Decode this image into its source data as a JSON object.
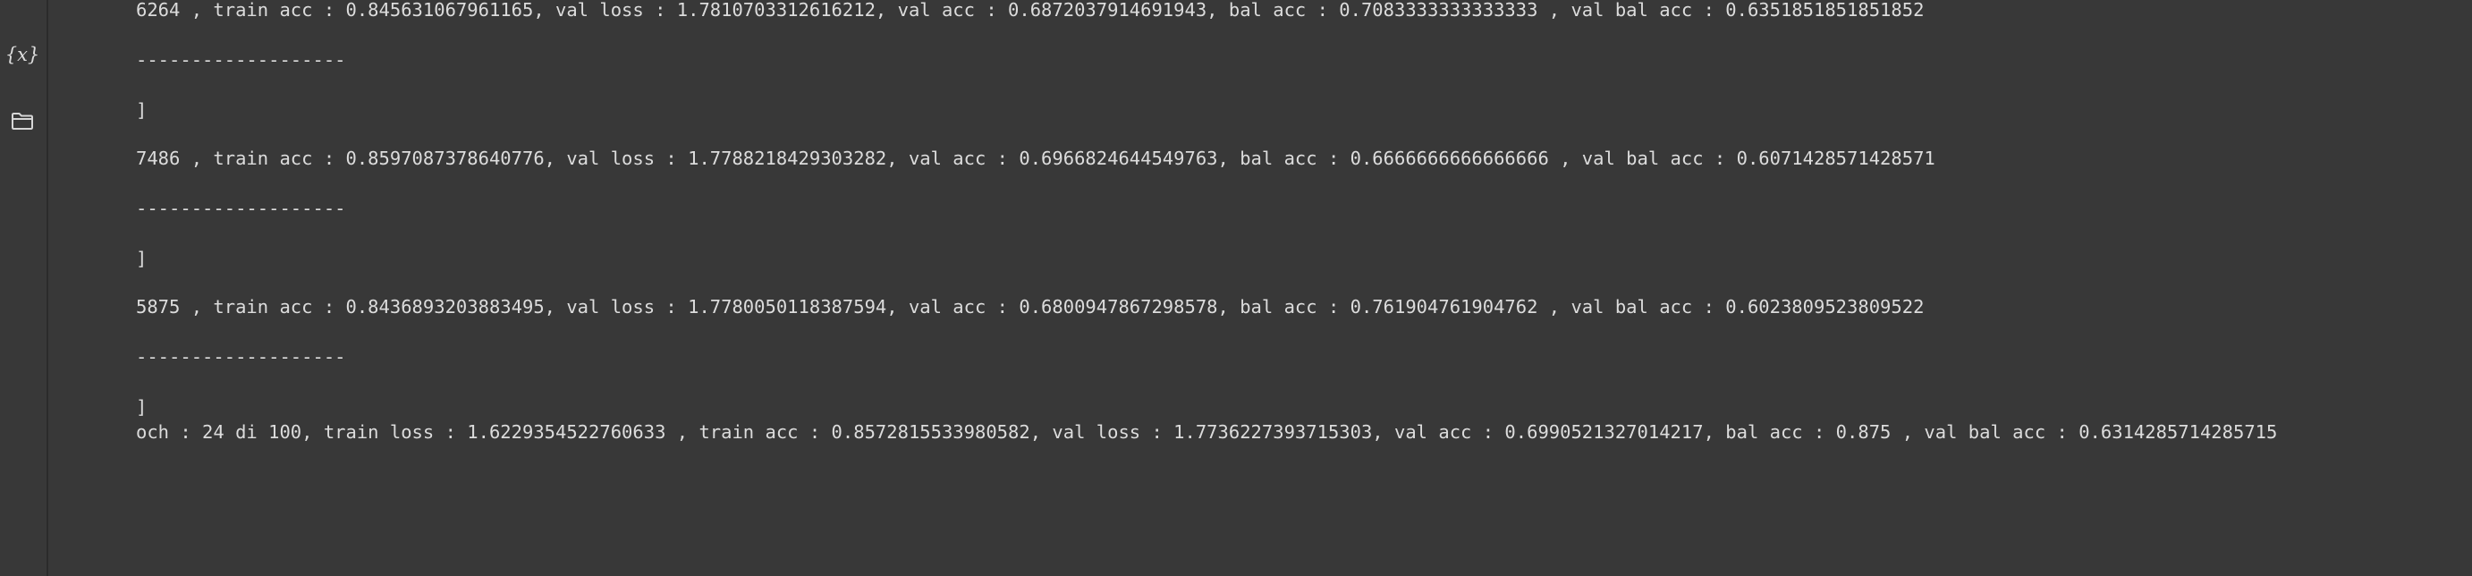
{
  "sidebar": {
    "variables_icon": "{x}",
    "folder_icon": "folder-icon"
  },
  "output": {
    "lines": [
      "6264 , train acc : 0.845631067961165, val loss : 1.7810703312616212, val acc : 0.6872037914691943, bal acc : 0.7083333333333333 , val bal acc : 0.6351851851851852",
      "-------------------",
      "]",
      "7486 , train acc : 0.8597087378640776, val loss : 1.7788218429303282, val acc : 0.6966824644549763, bal acc : 0.6666666666666666 , val bal acc : 0.6071428571428571",
      "-------------------",
      "]",
      "5875 , train acc : 0.8436893203883495, val loss : 1.7780050118387594, val acc : 0.6800947867298578, bal acc : 0.761904761904762 , val bal acc : 0.6023809523809522",
      "-------------------",
      "]",
      "och : 24 di 100, train loss : 1.6229354522760633 , train acc : 0.8572815533980582, val loss : 1.7736227393715303, val acc : 0.6990521327014217, bal acc : 0.875 , val bal acc : 0.6314285714285715"
    ]
  }
}
